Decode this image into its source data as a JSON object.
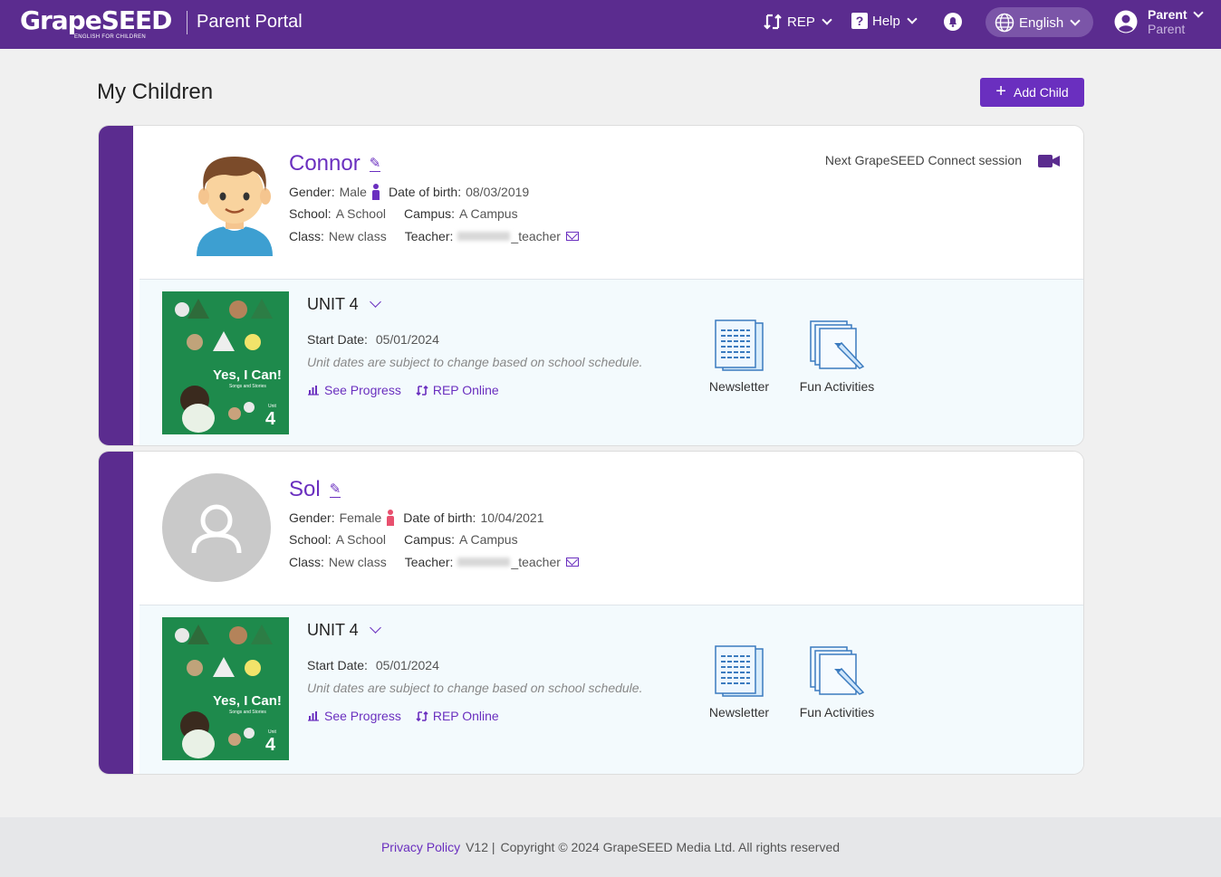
{
  "header": {
    "logo_text": "GrapeSEED",
    "logo_subtitle": "ENGLISH FOR CHILDREN",
    "portal_title": "Parent Portal",
    "rep_label": "REP",
    "help_label": "Help",
    "language_label": "English",
    "user_name": "Parent",
    "user_role": "Parent"
  },
  "page": {
    "title": "My Children",
    "add_child_label": "Add Child"
  },
  "labels": {
    "gender": "Gender:",
    "dob": "Date of birth:",
    "school": "School:",
    "campus": "Campus:",
    "class": "Class:",
    "teacher": "Teacher:",
    "start_date": "Start Date:",
    "note": "Unit dates are subject to change based on school schedule.",
    "see_progress": "See Progress",
    "rep_online": "REP Online",
    "newsletter": "Newsletter",
    "fun_activities": "Fun Activities",
    "connect": "Next GrapeSEED Connect session"
  },
  "children": [
    {
      "name": "Connor",
      "gender": "Male",
      "dob": "08/03/2019",
      "school": "A School",
      "campus": "A Campus",
      "class": "New class",
      "teacher": "_teacher",
      "unit": "UNIT 4",
      "start_date": "05/01/2024",
      "book_title": "Yes, I Can!",
      "book_subtitle": "Songs and Stories",
      "book_unit_label": "Unit",
      "book_unit_number": "4"
    },
    {
      "name": "Sol",
      "gender": "Female",
      "dob": "10/04/2021",
      "school": "A School",
      "campus": "A Campus",
      "class": "New class",
      "teacher": "_teacher",
      "unit": "UNIT 4",
      "start_date": "05/01/2024",
      "book_title": "Yes, I Can!",
      "book_subtitle": "Songs and Stories",
      "book_unit_label": "Unit",
      "book_unit_number": "4"
    }
  ],
  "footer": {
    "privacy": "Privacy Policy",
    "version": "V12 |",
    "copyright": "Copyright © 2024 GrapeSEED Media Ltd. All rights reserved"
  },
  "colors": {
    "brand": "#5b2c8f",
    "accent": "#6a2fbf",
    "male": "#6a2fbf",
    "female": "#e8506e"
  },
  "icons": [
    "rep-icon",
    "help-icon",
    "bell-icon",
    "globe-icon",
    "user-icon",
    "plus-icon",
    "pencil-icon",
    "person-icon",
    "mail-icon",
    "video-camera-icon",
    "chart-icon",
    "newsletter-icon",
    "fun-activities-icon"
  ]
}
